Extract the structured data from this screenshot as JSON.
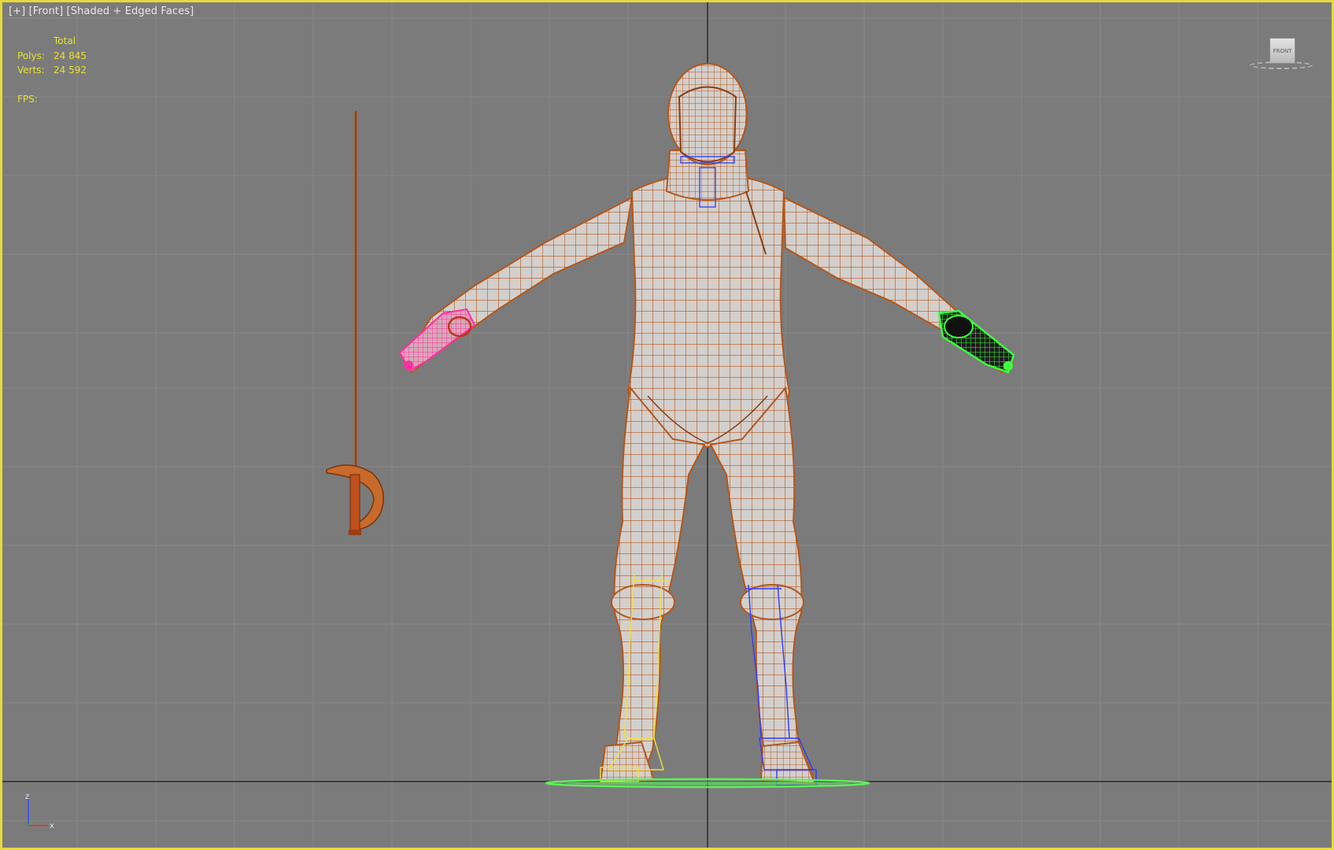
{
  "viewport": {
    "label_plus": "[+]",
    "label_view": "[Front]",
    "label_shading": "[Shaded + Edged Faces]",
    "border_color": "#e6d93b",
    "background_color": "#7b7b7b"
  },
  "stats": {
    "header": "Total",
    "polys_label": "Polys:",
    "polys_value": "24 845",
    "verts_label": "Verts:",
    "verts_value": "24 592",
    "fps_label": "FPS:",
    "text_color": "#e8e035"
  },
  "viewcube": {
    "face_label": "FRONT"
  },
  "axis_tripod": {
    "z_label": "z",
    "x_label": "x"
  },
  "scene": {
    "mesh_wire_color": "#b4561a",
    "mesh_fill_color": "#cfcbc8",
    "left_glove_color": "#ff2fa0",
    "right_glove_color": "#3dff3d",
    "ground_helper_color": "#5cf05c",
    "left_leg_bone_color": "#f0e040",
    "right_leg_bone_color": "#2a3cff"
  }
}
